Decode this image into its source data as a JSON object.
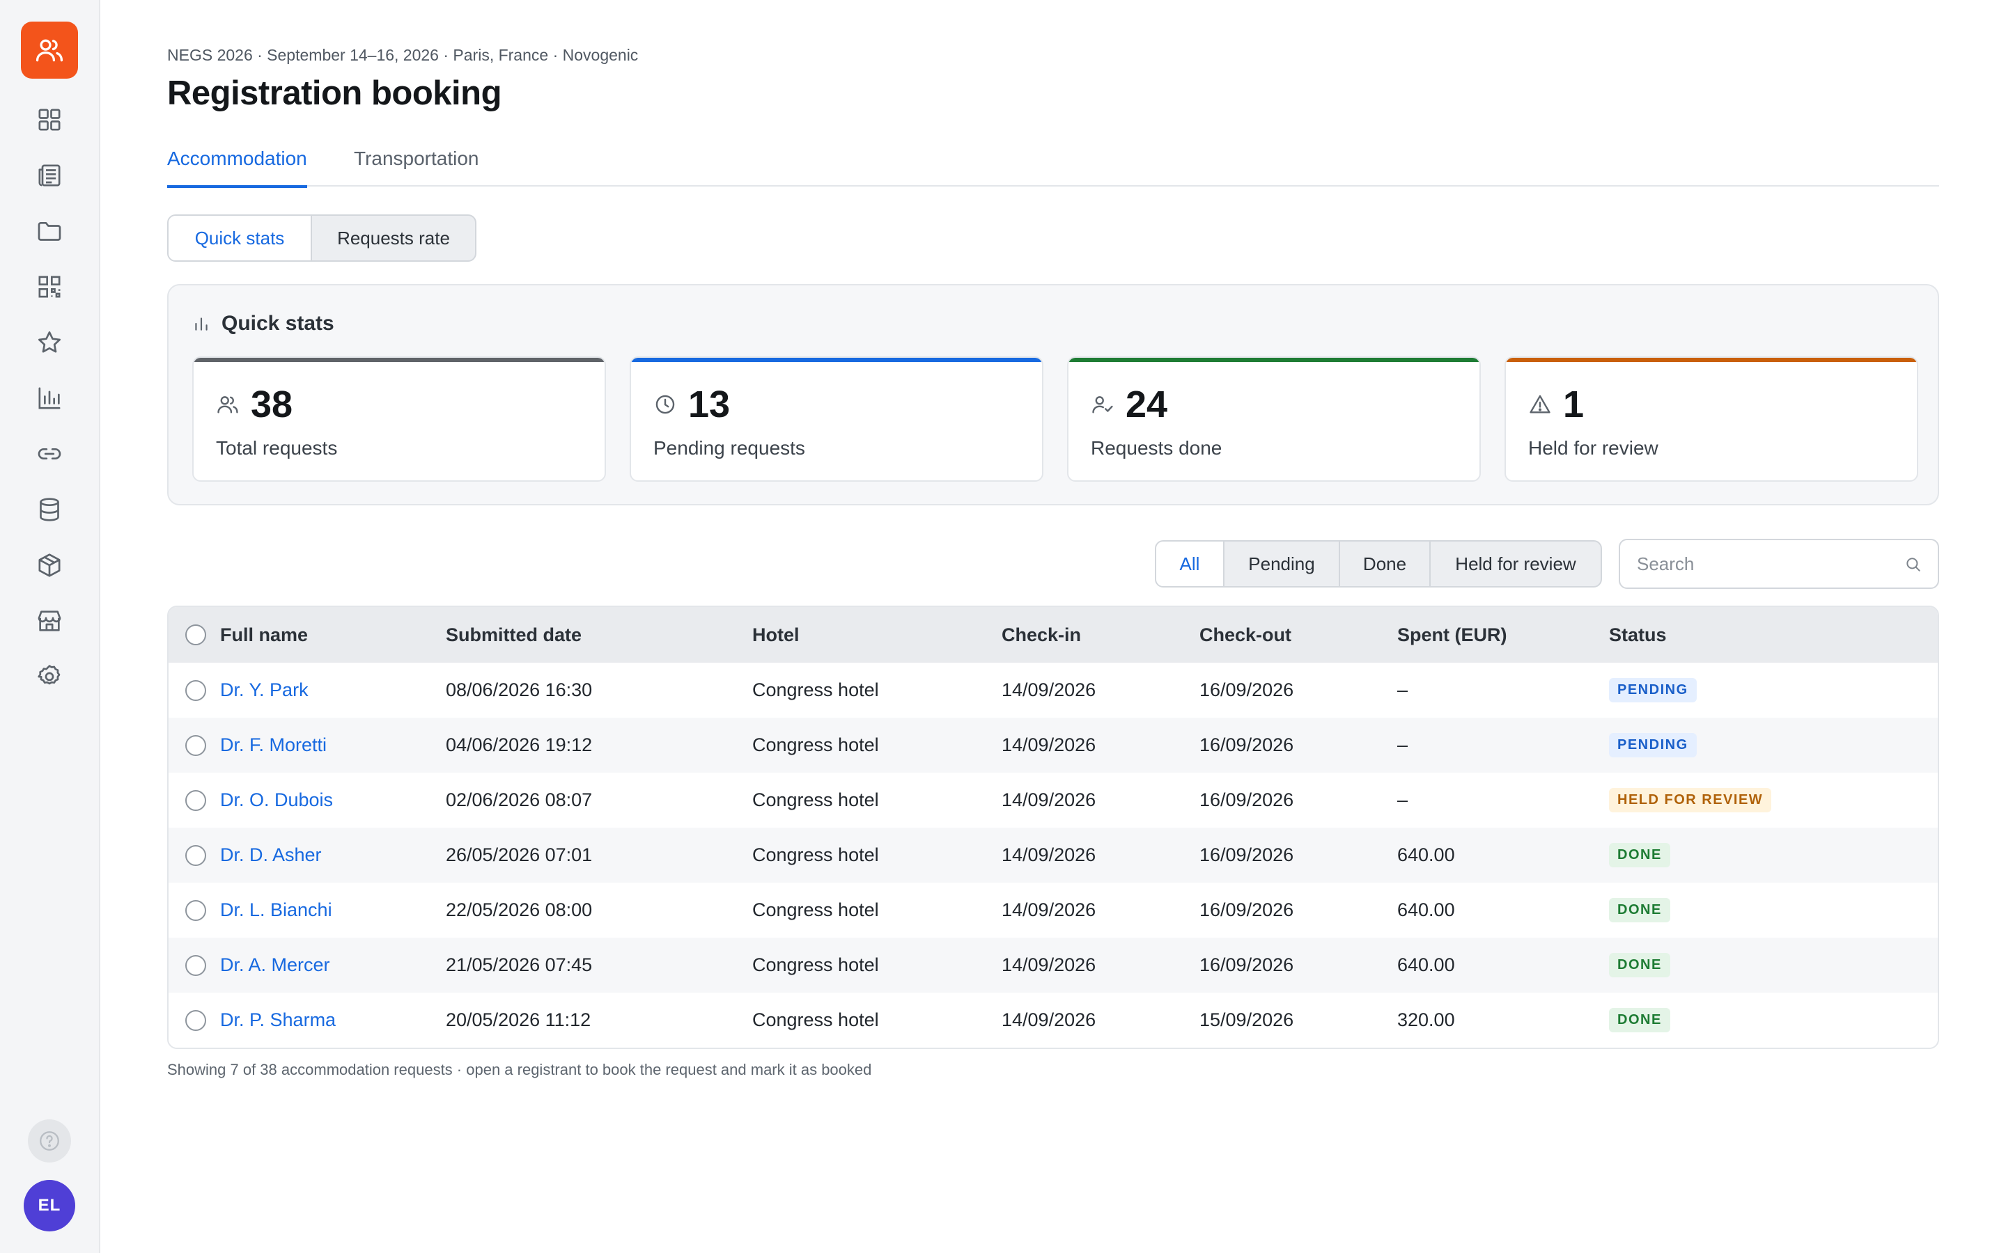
{
  "user": {
    "initials": "EL"
  },
  "header": {
    "eyebrow": "NEGS 2026 · September 14–16, 2026 · Paris, France · Novogenic",
    "title": "Registration booking"
  },
  "tabs": [
    {
      "label": "Accommodation",
      "active": true
    },
    {
      "label": "Transportation",
      "active": false
    }
  ],
  "view_toggle": [
    {
      "label": "Quick stats",
      "active": true
    },
    {
      "label": "Requests rate",
      "active": false
    }
  ],
  "stats": {
    "title": "Quick stats",
    "cards": [
      {
        "value": "38",
        "label": "Total requests",
        "color": "#5f6368",
        "icon": "users-icon"
      },
      {
        "value": "13",
        "label": "Pending requests",
        "color": "#1769e0",
        "icon": "clock-icon"
      },
      {
        "value": "24",
        "label": "Requests done",
        "color": "#1e7c34",
        "icon": "user-check-icon"
      },
      {
        "value": "1",
        "label": "Held for review",
        "color": "#c95f0a",
        "icon": "warning-icon"
      }
    ]
  },
  "filters": [
    {
      "label": "All",
      "active": true
    },
    {
      "label": "Pending",
      "active": false
    },
    {
      "label": "Done",
      "active": false
    },
    {
      "label": "Held for review",
      "active": false
    }
  ],
  "search": {
    "placeholder": "Search",
    "value": ""
  },
  "table": {
    "columns": [
      "Full name",
      "Submitted date",
      "Hotel",
      "Check-in",
      "Check-out",
      "Spent (EUR)",
      "Status"
    ],
    "rows": [
      {
        "name": "Dr. Y. Park",
        "submitted": "08/06/2026 16:30",
        "hotel": "Congress hotel",
        "checkin": "14/09/2026",
        "checkout": "16/09/2026",
        "spent": "–",
        "status": "PENDING"
      },
      {
        "name": "Dr. F. Moretti",
        "submitted": "04/06/2026 19:12",
        "hotel": "Congress hotel",
        "checkin": "14/09/2026",
        "checkout": "16/09/2026",
        "spent": "–",
        "status": "PENDING"
      },
      {
        "name": "Dr. O. Dubois",
        "submitted": "02/06/2026 08:07",
        "hotel": "Congress hotel",
        "checkin": "14/09/2026",
        "checkout": "16/09/2026",
        "spent": "–",
        "status": "HELD FOR REVIEW"
      },
      {
        "name": "Dr. D. Asher",
        "submitted": "26/05/2026 07:01",
        "hotel": "Congress hotel",
        "checkin": "14/09/2026",
        "checkout": "16/09/2026",
        "spent": "640.00",
        "status": "DONE"
      },
      {
        "name": "Dr. L. Bianchi",
        "submitted": "22/05/2026 08:00",
        "hotel": "Congress hotel",
        "checkin": "14/09/2026",
        "checkout": "16/09/2026",
        "spent": "640.00",
        "status": "DONE"
      },
      {
        "name": "Dr. A. Mercer",
        "submitted": "21/05/2026 07:45",
        "hotel": "Congress hotel",
        "checkin": "14/09/2026",
        "checkout": "16/09/2026",
        "spent": "640.00",
        "status": "DONE"
      },
      {
        "name": "Dr. P. Sharma",
        "submitted": "20/05/2026 11:12",
        "hotel": "Congress hotel",
        "checkin": "14/09/2026",
        "checkout": "15/09/2026",
        "spent": "320.00",
        "status": "DONE"
      }
    ]
  },
  "footnote": "Showing 7 of 38 accommodation requests · open a registrant to book the request and mark it as booked",
  "colors": {
    "accent": "#1769e0",
    "brand": "#f3541b",
    "avatar": "#4f3fd6"
  }
}
